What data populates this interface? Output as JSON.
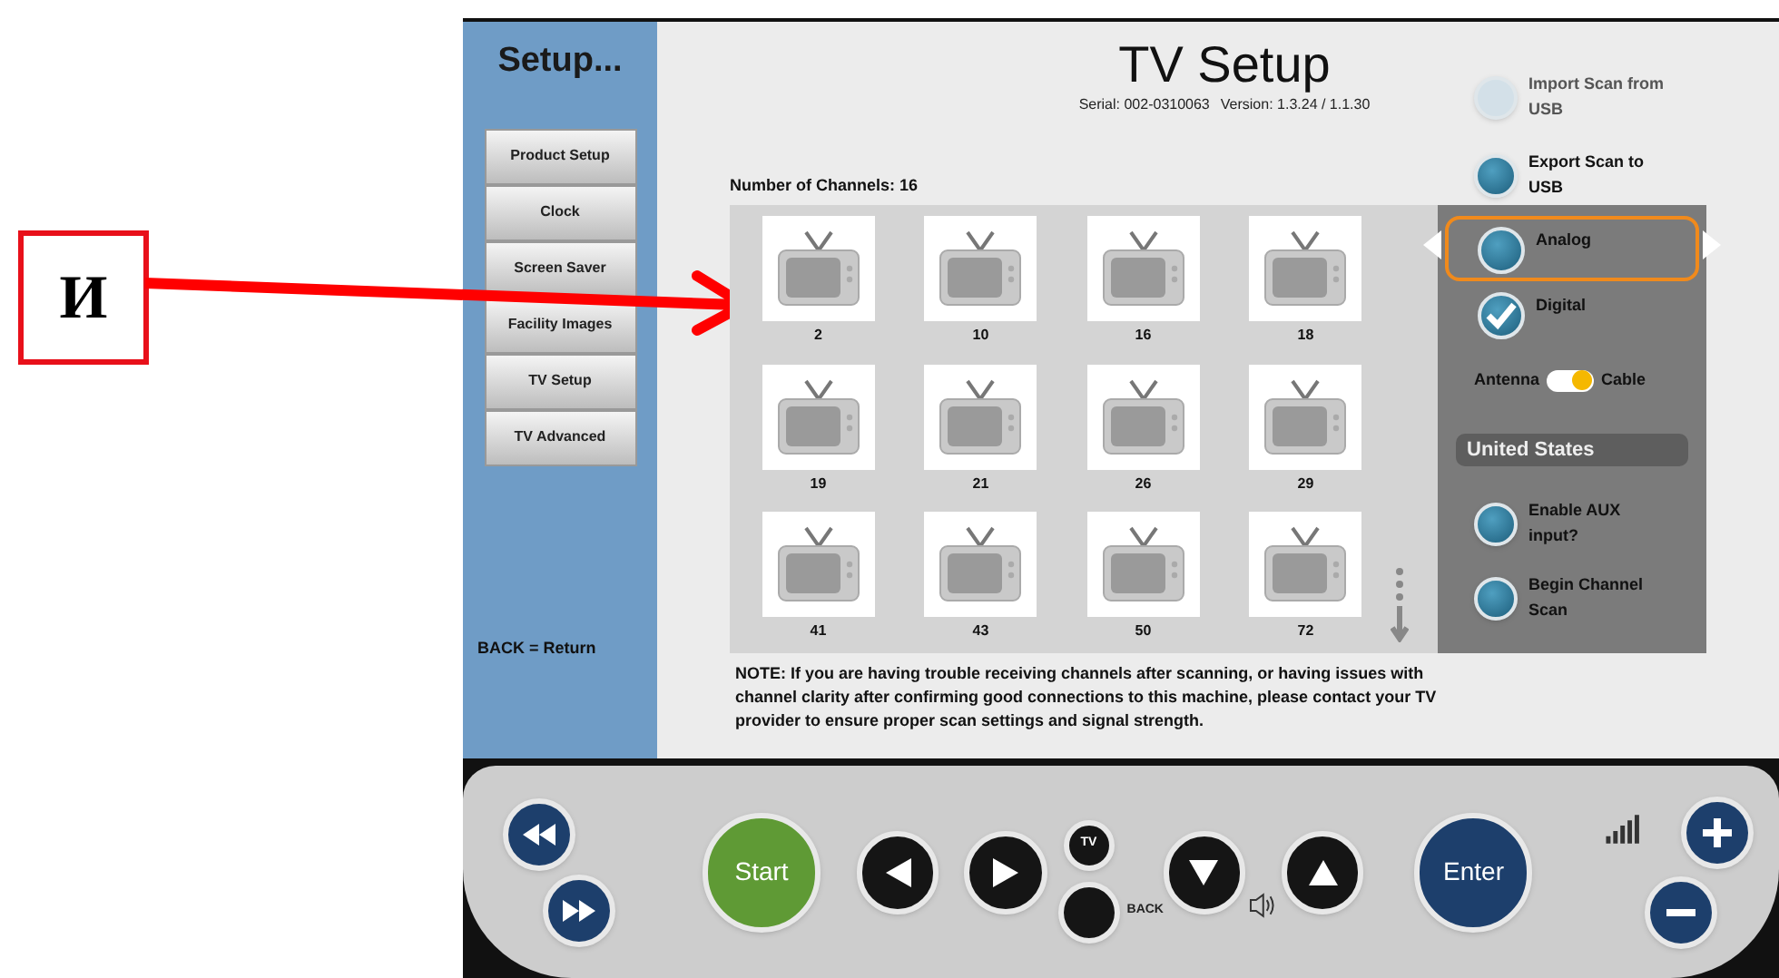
{
  "annotation": {
    "label": "И"
  },
  "sidebar": {
    "title": "Setup...",
    "items": [
      {
        "label": "Product Setup"
      },
      {
        "label": "Clock"
      },
      {
        "label": "Screen Saver"
      },
      {
        "label": "Facility Images"
      },
      {
        "label": "TV Setup"
      },
      {
        "label": "TV Advanced"
      }
    ],
    "footer": "BACK = Return"
  },
  "header": {
    "title": "TV Setup",
    "serial": "Serial: 002-0310063",
    "version": "Version: 1.3.24 / 1.1.30"
  },
  "top_actions": [
    {
      "label": "Import Scan from USB",
      "disabled": true
    },
    {
      "label": "Export Scan to USB",
      "disabled": false
    }
  ],
  "channels": {
    "count_label": "Number of Channels: 16",
    "items": [
      "2",
      "10",
      "16",
      "18",
      "19",
      "21",
      "26",
      "29",
      "41",
      "43",
      "50",
      "72"
    ]
  },
  "panel": {
    "modes": [
      {
        "label": "Analog",
        "checked": false,
        "focused": true
      },
      {
        "label": "Digital",
        "checked": true,
        "focused": false
      }
    ],
    "switch": {
      "left": "Antenna",
      "right": "Cable",
      "on": true
    },
    "region": "United States",
    "actions": [
      {
        "label": "Enable AUX input?"
      },
      {
        "label": "Begin Channel Scan"
      }
    ]
  },
  "note": "NOTE: If you are having trouble receiving channels after scanning, or having issues with channel clarity after confirming good connections to this machine, please contact your TV provider to ensure proper scan settings and signal strength.",
  "controls": {
    "start": "Start",
    "tv": "TV",
    "back": "BACK",
    "enter": "Enter"
  }
}
